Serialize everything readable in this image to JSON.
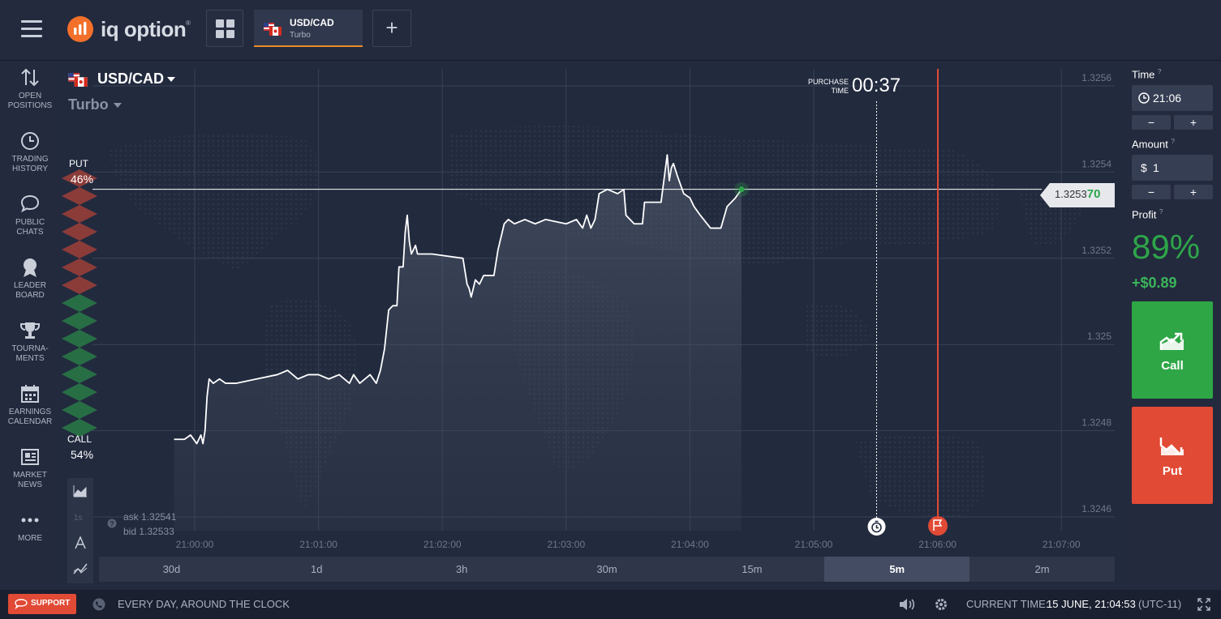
{
  "app": {
    "brand": "iq option",
    "brand_mark": "®"
  },
  "tabs": [
    {
      "pair": "USD/CAD",
      "type": "Turbo"
    }
  ],
  "sidebar": {
    "items": [
      {
        "label_lines": [
          "OPEN",
          "POSITIONS"
        ],
        "icon": "arrows-up-down-icon"
      },
      {
        "label_lines": [
          "TRADING",
          "HISTORY"
        ],
        "icon": "clock-icon"
      },
      {
        "label_lines": [
          "PUBLIC",
          "CHATS"
        ],
        "icon": "chat-icon"
      },
      {
        "label_lines": [
          "LEADER",
          "BOARD"
        ],
        "icon": "medal-icon"
      },
      {
        "label_lines": [
          "TOURNA-",
          "MENTS"
        ],
        "icon": "trophy-icon"
      },
      {
        "label_lines": [
          "EARNINGS",
          "CALENDAR"
        ],
        "icon": "calendar-icon"
      },
      {
        "label_lines": [
          "MARKET",
          "NEWS"
        ],
        "icon": "newspaper-icon"
      },
      {
        "label_lines": [
          "MORE"
        ],
        "icon": "dots-icon"
      }
    ]
  },
  "chart": {
    "pair": "USD/CAD",
    "type": "Turbo",
    "put_label": "PUT",
    "put_pct": "46%",
    "call_label": "CALL",
    "call_pct": "54%",
    "purchase_time_label_1": "PURCHASE",
    "purchase_time_label_2": "TIME",
    "purchase_timer": "00:37",
    "current_price_main": "1.3253",
    "current_price_tail": "70",
    "ask_label": "ask",
    "ask": "1.32541",
    "bid_label": "bid",
    "bid": "1.32533",
    "periods": [
      "30d",
      "1d",
      "3h",
      "30m",
      "15m",
      "5m",
      "2m"
    ],
    "active_period": "5m",
    "colors": {
      "up": "#2ea54a",
      "down": "#e14a35",
      "expiry_line": "#e14a35"
    }
  },
  "chart_data": {
    "type": "line",
    "x_ticks": [
      "21:00:00",
      "21:01:00",
      "21:02:00",
      "21:03:00",
      "21:04:00",
      "21:05:00",
      "21:06:00",
      "21:07:00"
    ],
    "y_ticks": [
      "1.3256",
      "1.3254",
      "1.3252",
      "1.325",
      "1.3248",
      "1.3246"
    ],
    "ylim": [
      1.3246,
      1.3256
    ],
    "series": [
      {
        "points": [
          [
            "20:59:50",
            1.32478
          ],
          [
            "20:59:55",
            1.32478
          ],
          [
            "20:59:58",
            1.32479
          ],
          [
            "21:00:01",
            1.32477
          ],
          [
            "21:00:03",
            1.32479
          ],
          [
            "21:00:04",
            1.32477
          ],
          [
            "21:00:05",
            1.3248
          ],
          [
            "21:00:06",
            1.32488
          ],
          [
            "21:00:07",
            1.32492
          ],
          [
            "21:00:09",
            1.32491
          ],
          [
            "21:00:12",
            1.32492
          ],
          [
            "21:00:15",
            1.32491
          ],
          [
            "21:00:20",
            1.32491
          ],
          [
            "21:00:30",
            1.32492
          ],
          [
            "21:00:40",
            1.32493
          ],
          [
            "21:00:45",
            1.32494
          ],
          [
            "21:00:50",
            1.32492
          ],
          [
            "21:00:55",
            1.32493
          ],
          [
            "21:01:00",
            1.32493
          ],
          [
            "21:01:05",
            1.32492
          ],
          [
            "21:01:10",
            1.32493
          ],
          [
            "21:01:15",
            1.32491
          ],
          [
            "21:01:17",
            1.32493
          ],
          [
            "21:01:20",
            1.32491
          ],
          [
            "21:01:25",
            1.32493
          ],
          [
            "21:01:28",
            1.32491
          ],
          [
            "21:01:30",
            1.32494
          ],
          [
            "21:01:32",
            1.32499
          ],
          [
            "21:01:34",
            1.32508
          ],
          [
            "21:01:36",
            1.32509
          ],
          [
            "21:01:38",
            1.32509
          ],
          [
            "21:01:39",
            1.32518
          ],
          [
            "21:01:41",
            1.32518
          ],
          [
            "21:01:42",
            1.32526
          ],
          [
            "21:01:43",
            1.3253
          ],
          [
            "21:01:44",
            1.32524
          ],
          [
            "21:01:45",
            1.32521
          ],
          [
            "21:01:47",
            1.32523
          ],
          [
            "21:01:48",
            1.32521
          ],
          [
            "21:01:52",
            1.32521
          ],
          [
            "21:01:55",
            1.32521
          ],
          [
            "21:02:10",
            1.3252
          ],
          [
            "21:02:12",
            1.32514
          ],
          [
            "21:02:13",
            1.32513
          ],
          [
            "21:02:14",
            1.32511
          ],
          [
            "21:02:16",
            1.32515
          ],
          [
            "21:02:18",
            1.32514
          ],
          [
            "21:02:20",
            1.32516
          ],
          [
            "21:02:25",
            1.32516
          ],
          [
            "21:02:27",
            1.32522
          ],
          [
            "21:02:30",
            1.32528
          ],
          [
            "21:02:32",
            1.32529
          ],
          [
            "21:02:35",
            1.32528
          ],
          [
            "21:02:40",
            1.32529
          ],
          [
            "21:02:45",
            1.32528
          ],
          [
            "21:02:50",
            1.32529
          ],
          [
            "21:03:00",
            1.32528
          ],
          [
            "21:03:05",
            1.32529
          ],
          [
            "21:03:08",
            1.32527
          ],
          [
            "21:03:10",
            1.3253
          ],
          [
            "21:03:12",
            1.32527
          ],
          [
            "21:03:14",
            1.32529
          ],
          [
            "21:03:16",
            1.32535
          ],
          [
            "21:03:20",
            1.32536
          ],
          [
            "21:03:25",
            1.32535
          ],
          [
            "21:03:28",
            1.32536
          ],
          [
            "21:03:29",
            1.3253
          ],
          [
            "21:03:33",
            1.32528
          ],
          [
            "21:03:37",
            1.32528
          ],
          [
            "21:03:38",
            1.32533
          ],
          [
            "21:03:42",
            1.32533
          ],
          [
            "21:03:46",
            1.32533
          ],
          [
            "21:03:49",
            1.32544
          ],
          [
            "21:03:50",
            1.32538
          ],
          [
            "21:03:51",
            1.32541
          ],
          [
            "21:03:52",
            1.32542
          ],
          [
            "21:03:54",
            1.32539
          ],
          [
            "21:03:57",
            1.32535
          ],
          [
            "21:04:00",
            1.32534
          ],
          [
            "21:04:02",
            1.32532
          ],
          [
            "21:04:05",
            1.3253
          ],
          [
            "21:04:10",
            1.32527
          ],
          [
            "21:04:15",
            1.32527
          ],
          [
            "21:04:18",
            1.32532
          ],
          [
            "21:04:22",
            1.32534
          ],
          [
            "21:04:25",
            1.32536
          ]
        ]
      }
    ]
  },
  "panel": {
    "time_label": "Time",
    "time_value": "21:06",
    "amount_label": "Amount",
    "amount_currency": "$",
    "amount_value": "1",
    "minus": "−",
    "plus": "+",
    "profit_label": "Profit",
    "profit_pct": "89%",
    "profit_value": "+$0.89",
    "call_label": "Call",
    "put_label": "Put",
    "colors": {
      "call": "#2ea646",
      "put": "#e14a35",
      "profit": "#2ea54a"
    }
  },
  "footer": {
    "support_label": "SUPPORT",
    "support_hours": "EVERY DAY, AROUND THE CLOCK",
    "current_time_label": "CURRENT TIME:",
    "current_time_value": "15 JUNE, 21:04:53",
    "timezone": "(UTC-11)"
  }
}
